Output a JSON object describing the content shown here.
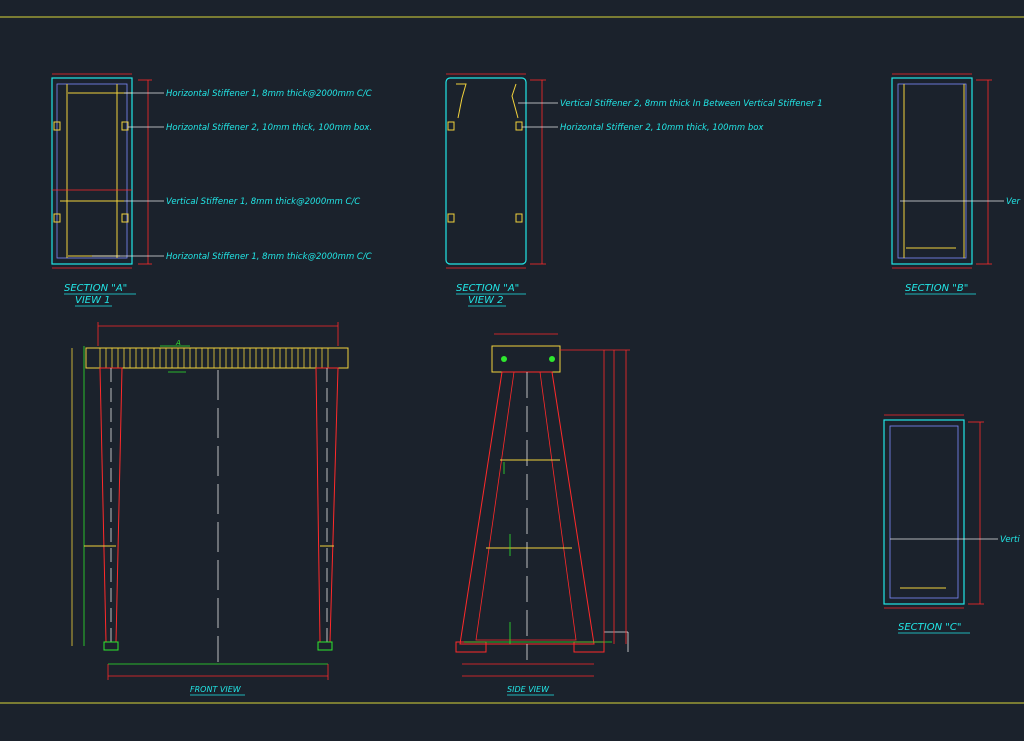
{
  "colors": {
    "background": "#1b222c",
    "cyan": "#22e6e6",
    "red": "#ff2a2a",
    "yellow": "#f2d23c",
    "green": "#2ee82e",
    "blue": "#7c8cff",
    "white": "#e6e6e6",
    "border": "#d8d63a"
  },
  "annotations": {
    "v1_h1": "Horizontal Stiffener 1, 8mm thick@2000mm C/C",
    "v1_h2": "Horizontal Stiffener 2, 10mm thick, 100mm box.",
    "v1_v1": "Vertical Stiffener 1, 8mm thick@2000mm C/C",
    "v1_h1b": "Horizontal Stiffener 1, 8mm thick@2000mm C/C",
    "v2_v2": "Vertical Stiffener 2, 8mm thick In Between Vertical Stiffener 1",
    "v2_h2": "Horizontal Stiffener 2, 10mm thick, 100mm box",
    "b_vert": "Ver",
    "c_vert": "Verti"
  },
  "titles": {
    "section_a1_line1": "SECTION \"A\"",
    "section_a1_line2": "VIEW 1",
    "section_a2_line1": "SECTION \"A\"",
    "section_a2_line2": "VIEW 2",
    "section_b": "SECTION \"B\"",
    "section_c": "SECTION \"C\"",
    "front_view": "FRONT VIEW",
    "side_view": "SIDE VIEW",
    "marker_a": "A"
  }
}
